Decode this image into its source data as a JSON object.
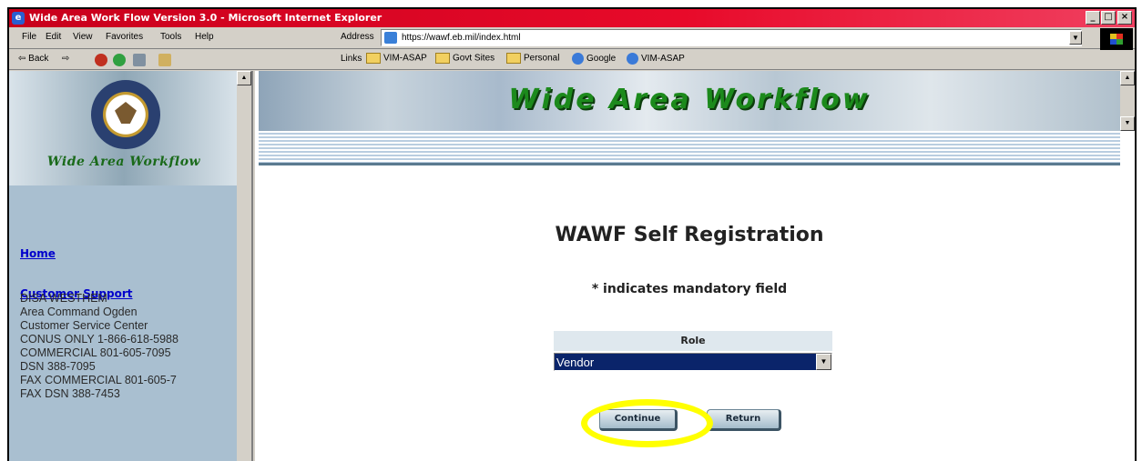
{
  "window": {
    "title": "Wide Area Work Flow Version 3.0 - Microsoft Internet Explorer",
    "controls": [
      "_",
      "□",
      "×"
    ]
  },
  "menu": {
    "items": [
      "File",
      "Edit",
      "View",
      "Favorites",
      "Tools",
      "Help"
    ],
    "address_label": "Address",
    "url": "https://wawf.eb.mil/index.html"
  },
  "toolbar": {
    "back_label": "Back",
    "links_label": "Links",
    "links": [
      "VIM-ASAP",
      "Govt Sites",
      "Personal",
      "Google",
      "VIM-ASAP"
    ]
  },
  "sidebar": {
    "title": "Wide Area Workflow",
    "nav": [
      "Home",
      "Customer Support"
    ],
    "info": [
      "DISA WESTHEM",
      "Area Command Ogden",
      "Customer Service Center",
      "CONUS ONLY 1-866-618-5988",
      "COMMERCIAL 801-605-7095",
      "DSN 388-7095",
      "FAX COMMERCIAL 801-605-7",
      "FAX DSN 388-7453"
    ]
  },
  "main": {
    "banner_title": "Wide Area Workflow",
    "heading": "WAWF Self Registration",
    "mandatory_note": "* indicates mandatory field",
    "role_label": "Role",
    "role_value": "Vendor",
    "continue_label": "Continue",
    "return_label": "Return"
  },
  "colors": {
    "titlebar": "#d0001e",
    "highlight": "#ffff00",
    "select_bg": "#0a246a",
    "banner_text": "#1c8a1c"
  }
}
